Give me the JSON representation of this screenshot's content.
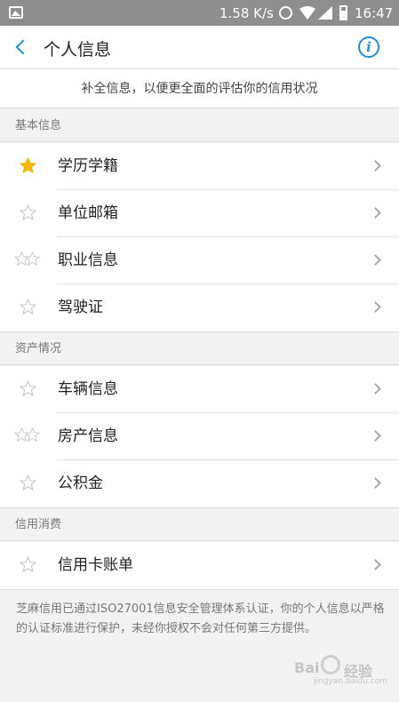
{
  "status_bar": {
    "network_speed": "1.58 K/s",
    "time": "16:47",
    "icons": [
      "gallery-icon",
      "alarm-icon",
      "wifi-icon",
      "signal-icon",
      "battery-icon"
    ]
  },
  "header": {
    "title": "个人信息",
    "back_icon": "chevron-left-icon",
    "info_icon": "info-icon"
  },
  "subtitle": "补全信息，以便更全面的评估你的信用状况",
  "sections": [
    {
      "title": "基本信息",
      "items": [
        {
          "label": "学历学籍",
          "star": "filled"
        },
        {
          "label": "单位邮箱",
          "star": "outline"
        },
        {
          "label": "职业信息",
          "star": "double"
        },
        {
          "label": "驾驶证",
          "star": "outline"
        }
      ]
    },
    {
      "title": "资产情况",
      "items": [
        {
          "label": "车辆信息",
          "star": "outline"
        },
        {
          "label": "房产信息",
          "star": "double"
        },
        {
          "label": "公积金",
          "star": "outline"
        }
      ]
    },
    {
      "title": "信用消费",
      "items": [
        {
          "label": "信用卡账单",
          "star": "outline"
        }
      ]
    }
  ],
  "footer_note": "芝麻信用已通过ISO27001信息安全管理体系认证，你的个人信息以严格的认证标准进行保护，未经你授权不会对任何第三方提供。",
  "watermark": {
    "brand": "Bai",
    "brand2": "经验",
    "url": "jingyan.baidu.com"
  },
  "colors": {
    "accent": "#1e90d8",
    "star_filled": "#f7b500",
    "star_outline": "#c9c9c9",
    "status_bar_bg": "#8e8e8e"
  }
}
